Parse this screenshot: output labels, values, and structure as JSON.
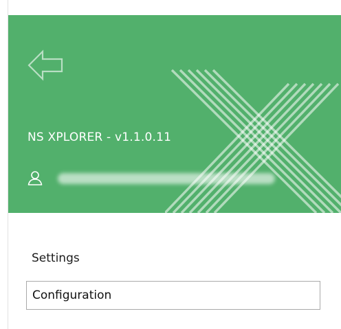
{
  "header": {
    "background_color": "#52b06c",
    "back_icon": "back-arrow-icon",
    "app_title": "NS XPLORER - v1.1.0.11",
    "user_icon": "user-icon",
    "watermark_icon": "x-logo-watermark-icon"
  },
  "settings": {
    "section_label": "Settings",
    "configuration_value": "Configuration"
  }
}
